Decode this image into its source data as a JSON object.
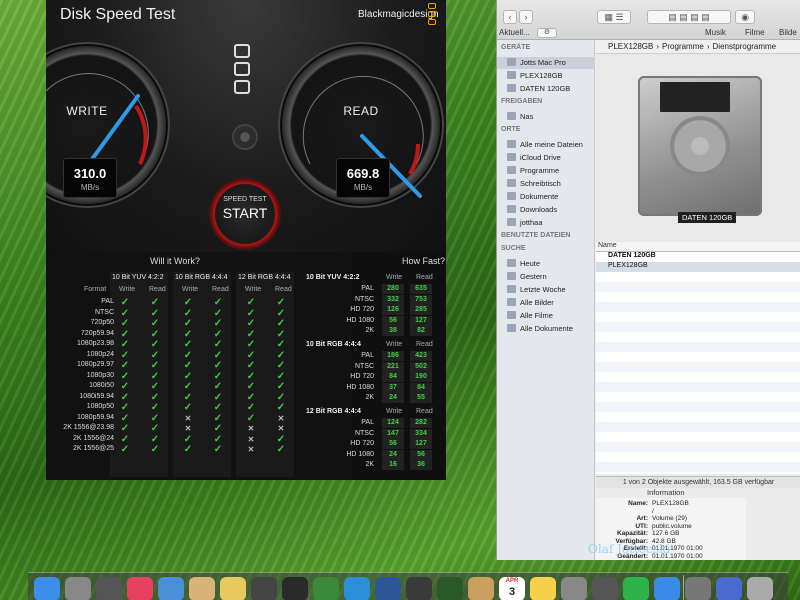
{
  "dst": {
    "title": "Disk Speed Test",
    "brand": "Blackmagicdesign",
    "write_label": "WRITE",
    "read_label": "READ",
    "write_value": "310.0",
    "read_value": "669.8",
    "unit": "MB/s",
    "start_top": "SPEED TEST",
    "start_label": "START",
    "will_title": "Will it Work?",
    "fast_title": "How Fast?",
    "format_label": "Format",
    "write_col": "Write",
    "read_col": "Read",
    "codecs": [
      "10 Bit YUV 4:2:2",
      "10 Bit RGB 4:4:4",
      "12 Bit RGB 4:4:4"
    ],
    "formats": [
      "PAL",
      "NTSC",
      "720p50",
      "720p59.94",
      "1080p23.98",
      "1080p24",
      "1080p29.97",
      "1080p30",
      "1080i50",
      "1080i59.94",
      "1080p50",
      "1080p59.94",
      "2K 1556@23.98",
      "2K 1556@24",
      "2K 1556@25"
    ],
    "speed_groups": [
      {
        "name": "10 Bit YUV 4:2:2",
        "rows": [
          {
            "label": "PAL",
            "write": "280",
            "read": "635"
          },
          {
            "label": "NTSC",
            "write": "332",
            "read": "753"
          },
          {
            "label": "HD 720",
            "write": "126",
            "read": "285"
          },
          {
            "label": "HD 1080",
            "write": "56",
            "read": "127"
          },
          {
            "label": "2K",
            "write": "38",
            "read": "82"
          }
        ]
      },
      {
        "name": "10 Bit RGB 4:4:4",
        "rows": [
          {
            "label": "PAL",
            "write": "186",
            "read": "423"
          },
          {
            "label": "NTSC",
            "write": "221",
            "read": "502"
          },
          {
            "label": "HD 720",
            "write": "84",
            "read": "190"
          },
          {
            "label": "HD 1080",
            "write": "37",
            "read": "84"
          },
          {
            "label": "2K",
            "write": "24",
            "read": "55"
          }
        ]
      },
      {
        "name": "12 Bit RGB 4:4:4",
        "rows": [
          {
            "label": "PAL",
            "write": "124",
            "read": "282"
          },
          {
            "label": "NTSC",
            "write": "147",
            "read": "334"
          },
          {
            "label": "HD 720",
            "write": "56",
            "read": "127"
          },
          {
            "label": "HD 1080",
            "write": "24",
            "read": "56"
          },
          {
            "label": "2K",
            "write": "16",
            "read": "36"
          }
        ]
      }
    ]
  },
  "finder": {
    "tabs": [
      "Aktuell...",
      "Musik",
      "Filme",
      "Bilde"
    ],
    "path": [
      "PLEX128GB",
      "Programme",
      "Dienstprogramme"
    ],
    "sections": {
      "devices": "GERÄTE",
      "shared": "FREIGABEN",
      "places": "ORTE",
      "tags": "BENUTZTE DATEIEN",
      "search": "SUCHE"
    },
    "devices": [
      "Jotts Mac Pro",
      "PLEX128GB",
      "DATEN 120GB"
    ],
    "shared": [
      "Nas"
    ],
    "places": [
      "Alle meine Dateien",
      "iCloud Drive",
      "Programme",
      "Schreibtisch",
      "Dokumente",
      "Downloads",
      "jotthaa"
    ],
    "search": [
      "Heute",
      "Gestern",
      "Letzte Woche",
      "Alle Bilder",
      "Alle Filme",
      "Alle Dokumente"
    ],
    "preview_caption": "DATEN 120GB",
    "list_header": "Name",
    "list_rows": [
      "DATEN 120GB",
      "PLEX128GB"
    ],
    "status": "1 von 2 Objekte ausgewählt, 163.5 GB verfügbar",
    "info_tab": "Information",
    "info": [
      {
        "k": "Name:",
        "v": "PLEX128GB"
      },
      {
        "k": "",
        "v": "/"
      },
      {
        "k": "Art:",
        "v": "Volume (29)"
      },
      {
        "k": "UTI:",
        "v": "public.volume"
      },
      {
        "k": "Kapazität:",
        "v": "127.6 GB"
      },
      {
        "k": "Verfügbar:",
        "v": "42.8 GB"
      },
      {
        "k": "Erstellt:",
        "v": "01.01.1970 01:00"
      },
      {
        "k": "Geändert:",
        "v": "01.01.1970 01:00"
      }
    ]
  },
  "dock": {
    "calendar_month": "APR",
    "calendar_day": "3"
  },
  "watermark": "Olaf Jotteeski"
}
